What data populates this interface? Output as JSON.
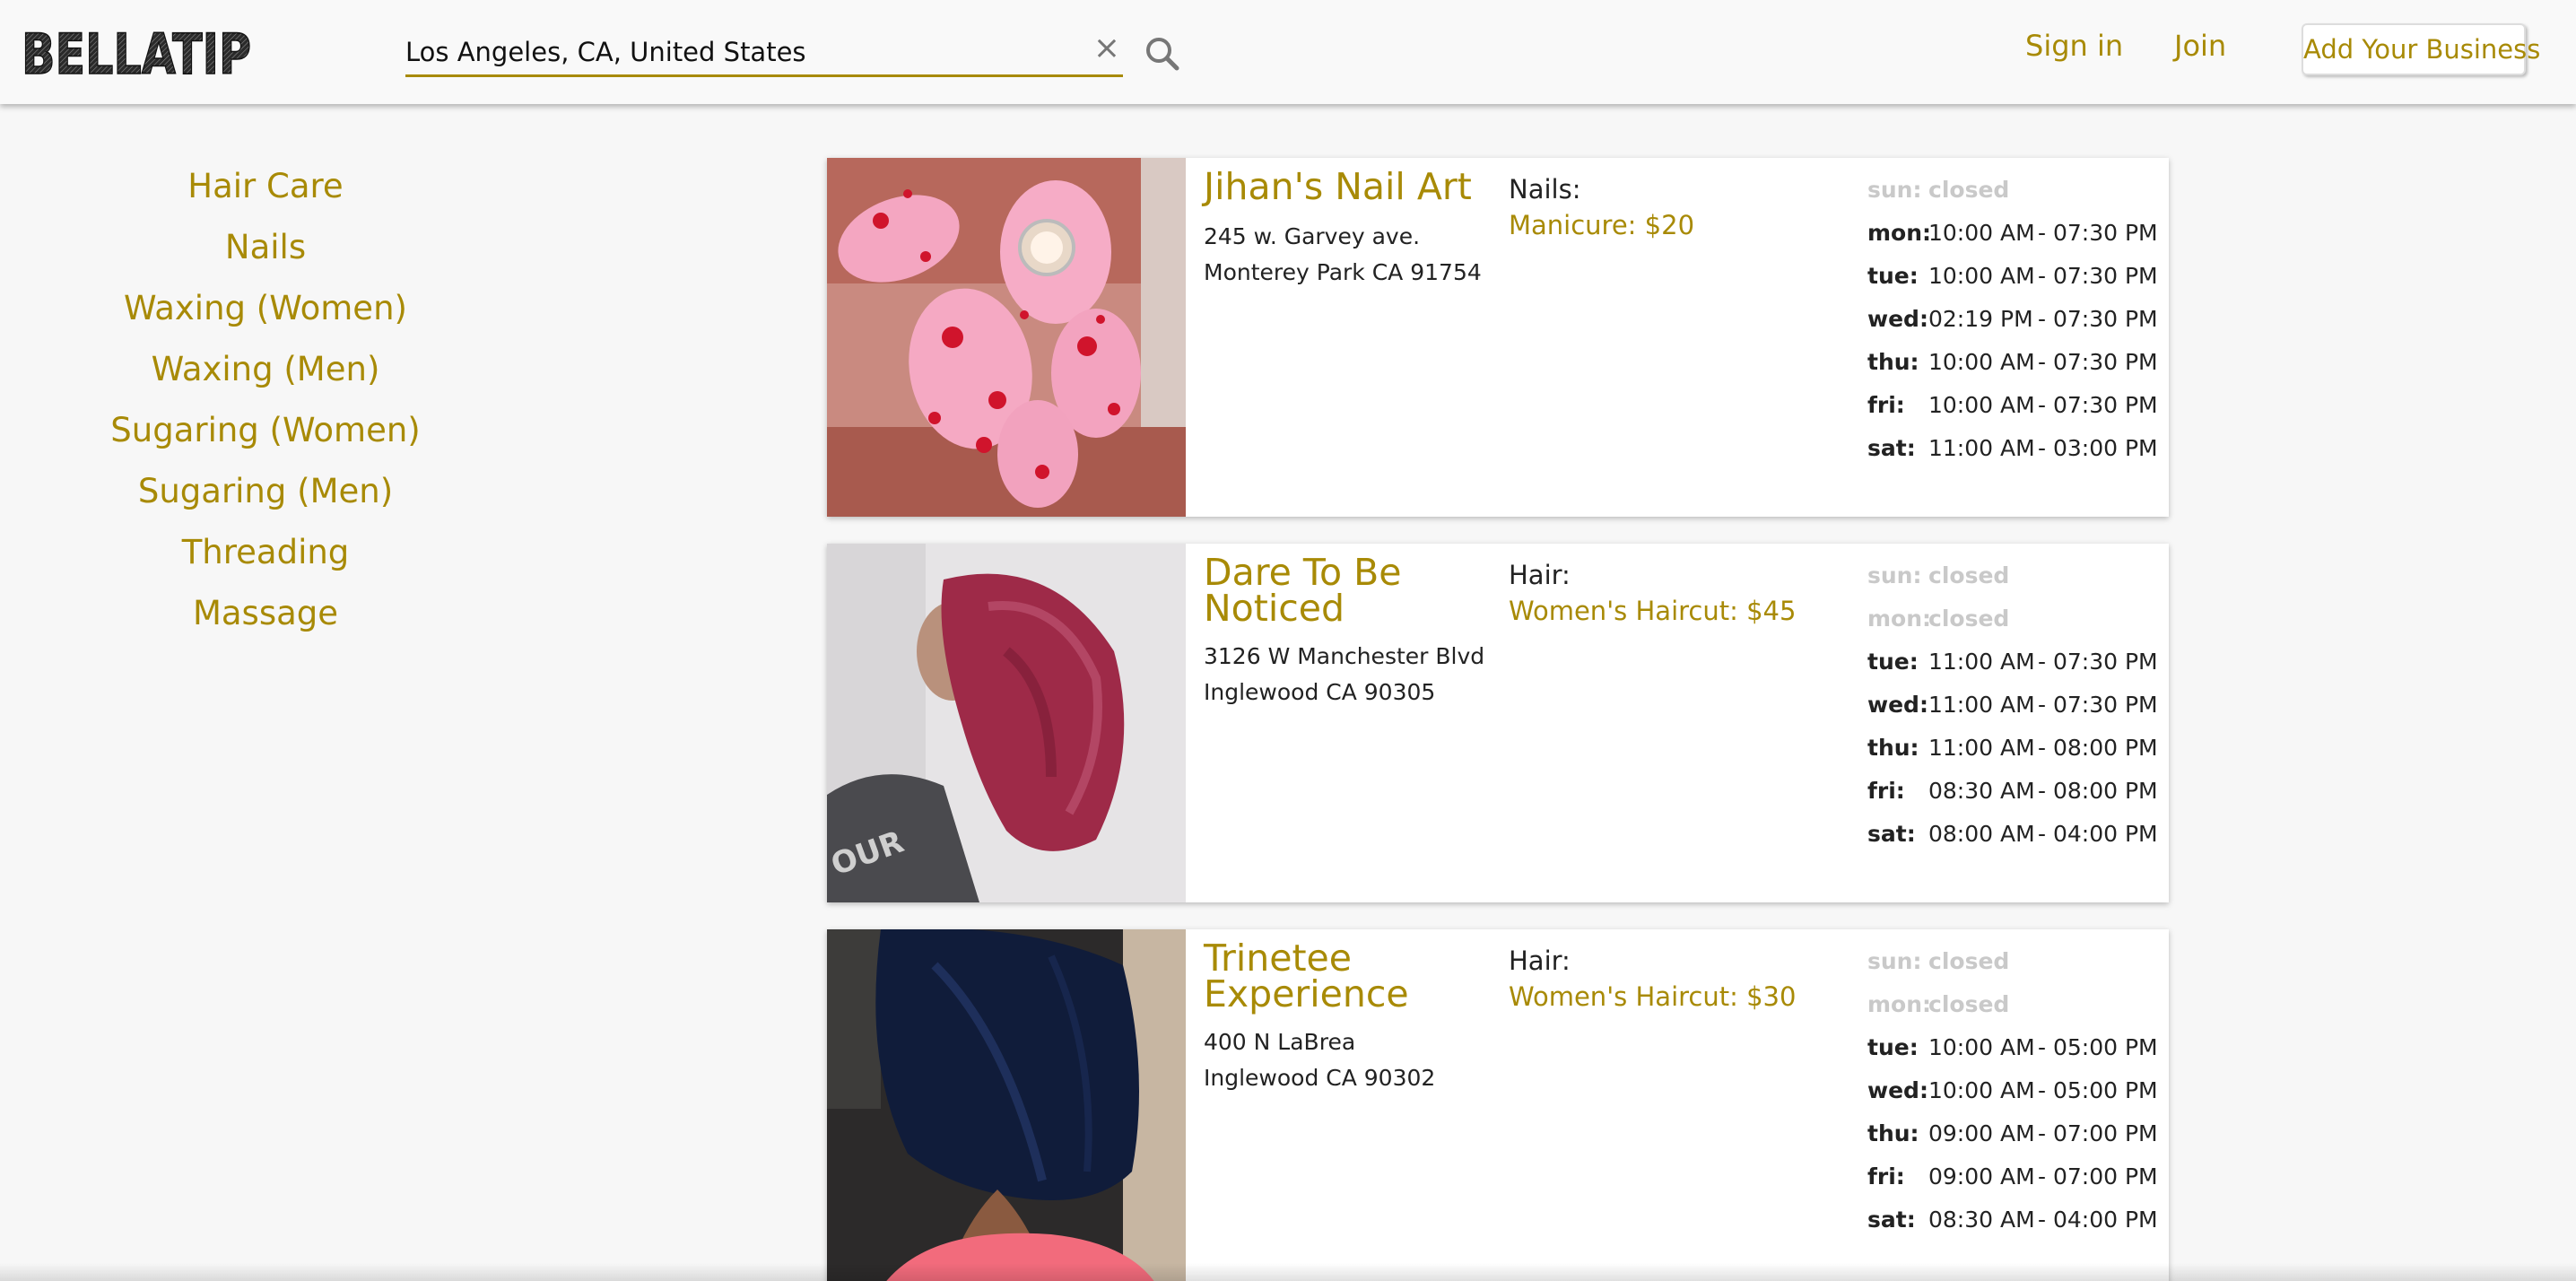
{
  "header": {
    "logo_text": "BELLATIP",
    "search": {
      "value": "Los Angeles, CA, United States",
      "placeholder": ""
    },
    "clear_label": "×",
    "nav": {
      "signin": "Sign in",
      "join": "Join",
      "add_business": "Add Your Business"
    }
  },
  "sidebar": {
    "categories": [
      "Hair Care",
      "Nails",
      "Waxing (Women)",
      "Waxing (Men)",
      "Sugaring (Women)",
      "Sugaring (Men)",
      "Threading",
      "Massage"
    ]
  },
  "listings": [
    {
      "name": "Jihan's Nail Art",
      "address1": "245 w. Garvey ave.",
      "address2": "Monterey Park CA 91754",
      "service_category": "Nails:",
      "service": "Manicure: $20",
      "image": "pink-nails-photo",
      "hours": [
        {
          "day": "sun:",
          "open": "closed",
          "close": "",
          "closed": true
        },
        {
          "day": "mon:",
          "open": "10:00 AM",
          "close": "- 07:30 PM",
          "closed": false
        },
        {
          "day": "tue:",
          "open": "10:00 AM",
          "close": "- 07:30 PM",
          "closed": false
        },
        {
          "day": "wed:",
          "open": "02:19 PM",
          "close": "- 07:30 PM",
          "closed": false
        },
        {
          "day": "thu:",
          "open": "10:00 AM",
          "close": "- 07:30 PM",
          "closed": false
        },
        {
          "day": "fri:",
          "open": "10:00 AM",
          "close": "- 07:30 PM",
          "closed": false
        },
        {
          "day": "sat:",
          "open": "11:00 AM",
          "close": "- 03:00 PM",
          "closed": false
        }
      ]
    },
    {
      "name": "Dare To Be Noticed",
      "address1": "3126 W Manchester Blvd",
      "address2": "Inglewood CA 90305",
      "service_category": "Hair:",
      "service": "Women's Haircut: $45",
      "image": "red-bob-photo",
      "hours": [
        {
          "day": "sun:",
          "open": "closed",
          "close": "",
          "closed": true
        },
        {
          "day": "mon:",
          "open": "closed",
          "close": "",
          "closed": true
        },
        {
          "day": "tue:",
          "open": "11:00 AM",
          "close": "- 07:30 PM",
          "closed": false
        },
        {
          "day": "wed:",
          "open": "11:00 AM",
          "close": "- 07:30 PM",
          "closed": false
        },
        {
          "day": "thu:",
          "open": "11:00 AM",
          "close": "- 08:00 PM",
          "closed": false
        },
        {
          "day": "fri:",
          "open": "08:30 AM",
          "close": "- 08:00 PM",
          "closed": false
        },
        {
          "day": "sat:",
          "open": "08:00 AM",
          "close": "- 04:00 PM",
          "closed": false
        }
      ]
    },
    {
      "name": "Trinetee Experience",
      "address1": "400 N LaBrea",
      "address2": "Inglewood CA 90302",
      "service_category": "Hair:",
      "service": "Women's Haircut: $30",
      "image": "black-bob-photo",
      "hours": [
        {
          "day": "sun:",
          "open": "closed",
          "close": "",
          "closed": true
        },
        {
          "day": "mon:",
          "open": "closed",
          "close": "",
          "closed": true
        },
        {
          "day": "tue:",
          "open": "10:00 AM",
          "close": "- 05:00 PM",
          "closed": false
        },
        {
          "day": "wed:",
          "open": "10:00 AM",
          "close": "- 05:00 PM",
          "closed": false
        },
        {
          "day": "thu:",
          "open": "09:00 AM",
          "close": "- 07:00 PM",
          "closed": false
        },
        {
          "day": "fri:",
          "open": "09:00 AM",
          "close": "- 07:00 PM",
          "closed": false
        },
        {
          "day": "sat:",
          "open": "08:30 AM",
          "close": "- 04:00 PM",
          "closed": false
        }
      ]
    }
  ],
  "colors": {
    "accent": "#a88a06",
    "closed": "#c9c9c9",
    "background": "#f7f7f7"
  }
}
